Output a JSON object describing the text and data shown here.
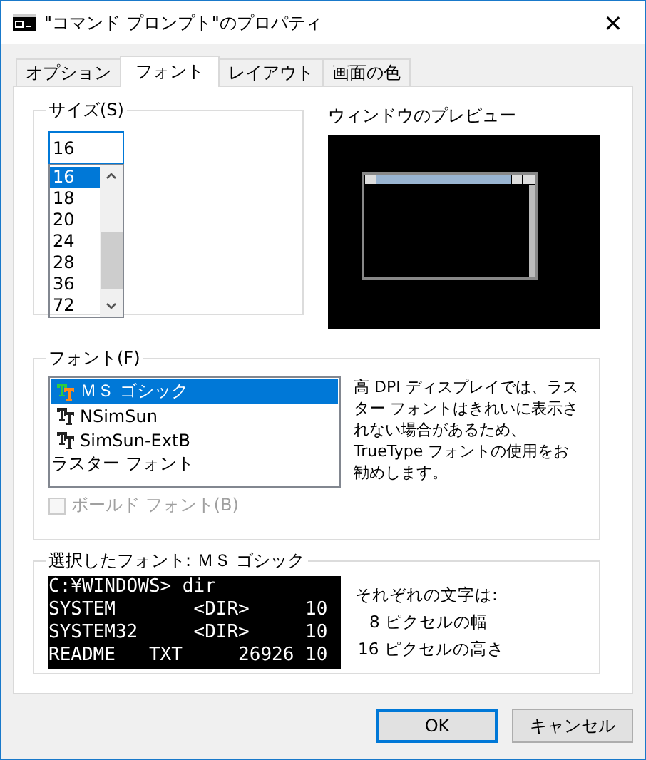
{
  "window": {
    "title": "\"コマンド プロンプト\"のプロパティ",
    "close": "✕"
  },
  "tabs": [
    {
      "label": "オプション",
      "selected": false
    },
    {
      "label": "フォント",
      "selected": true
    },
    {
      "label": "レイアウト",
      "selected": false
    },
    {
      "label": "画面の色",
      "selected": false
    }
  ],
  "size": {
    "legend": "サイズ(S)",
    "value": "16",
    "items": [
      {
        "label": "16",
        "selected": true
      },
      {
        "label": "18",
        "selected": false
      },
      {
        "label": "20",
        "selected": false
      },
      {
        "label": "24",
        "selected": false
      },
      {
        "label": "28",
        "selected": false
      },
      {
        "label": "36",
        "selected": false
      },
      {
        "label": "72",
        "selected": false
      }
    ]
  },
  "preview": {
    "label": "ウィンドウのプレビュー"
  },
  "font": {
    "legend": "フォント(F)",
    "items": [
      {
        "label": "ＭＳ ゴシック",
        "kind": "truetype",
        "selected": true
      },
      {
        "label": "NSimSun",
        "kind": "truetype",
        "selected": false
      },
      {
        "label": "SimSun-ExtB",
        "kind": "truetype",
        "selected": false
      },
      {
        "label": "ラスター フォント",
        "kind": "raster",
        "selected": false
      }
    ],
    "note": "高 DPI ディスプレイでは、ラスター フォントはきれいに表示されない場合があるため、TrueType フォントの使用をお勧めします。",
    "bold": {
      "label": "ボールド フォント(B)",
      "checked": false,
      "disabled": true
    }
  },
  "selected_font": {
    "legend": "選択したフォント: ＭＳ ゴシック",
    "sample": [
      "C:¥WINDOWS> dir",
      "SYSTEM       <DIR>     10",
      "SYSTEM32     <DIR>     10",
      "README   TXT     26926 10"
    ],
    "info": [
      "それぞれの文字は:",
      "8 ピクセルの幅",
      "16 ピクセルの高さ"
    ]
  },
  "buttons": [
    {
      "label": "OK",
      "default": true
    },
    {
      "label": "キャンセル",
      "default": false
    }
  ]
}
